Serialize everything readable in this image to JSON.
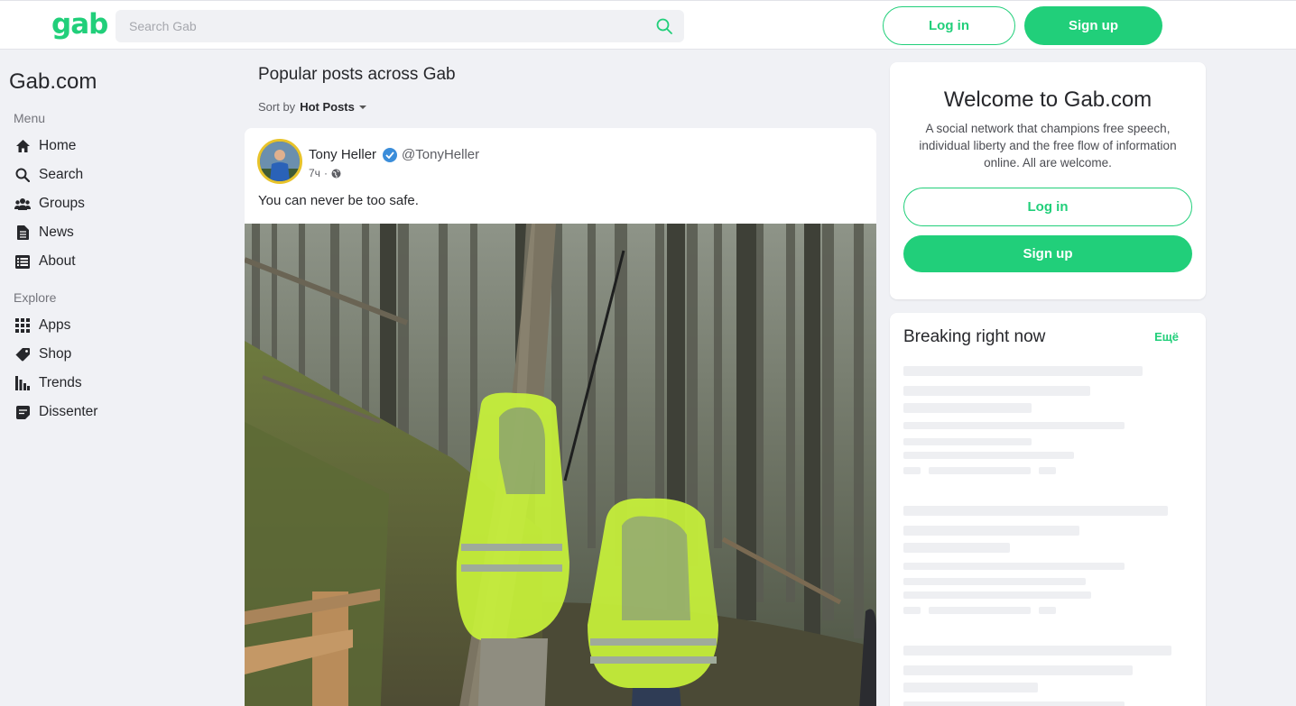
{
  "brand": {
    "logo": "gab",
    "accent_color": "#21cf7a"
  },
  "search": {
    "placeholder": "Search Gab",
    "icon": "search-icon"
  },
  "header": {
    "login_label": "Log in",
    "signup_label": "Sign up"
  },
  "sidebar": {
    "site_title": "Gab.com",
    "menu_label": "Menu",
    "menu_items": [
      {
        "label": "Home",
        "icon": "home-icon"
      },
      {
        "label": "Search",
        "icon": "search-icon"
      },
      {
        "label": "Groups",
        "icon": "groups-icon"
      },
      {
        "label": "News",
        "icon": "news-icon"
      },
      {
        "label": "About",
        "icon": "about-icon"
      }
    ],
    "explore_label": "Explore",
    "explore_items": [
      {
        "label": "Apps",
        "icon": "apps-icon"
      },
      {
        "label": "Shop",
        "icon": "shop-icon"
      },
      {
        "label": "Trends",
        "icon": "trends-icon"
      },
      {
        "label": "Dissenter",
        "icon": "dissenter-icon"
      }
    ]
  },
  "feed": {
    "title": "Popular posts across Gab",
    "sort_label": "Sort by",
    "sort_value": "Hot Posts"
  },
  "post": {
    "author_name": "Tony Heller",
    "verified": true,
    "handle": "@TonyHeller",
    "time": "7ч",
    "separator": "·",
    "visibility_icon": "globe-icon",
    "text": "You can never be too safe."
  },
  "welcome": {
    "title": "Welcome to Gab.com",
    "description": "A social network that champions free speech, individual liberty and the free flow of information online. All are welcome.",
    "login_label": "Log in",
    "signup_label": "Sign up"
  },
  "breaking": {
    "title": "Breaking right now",
    "more_label": "Ещё"
  }
}
